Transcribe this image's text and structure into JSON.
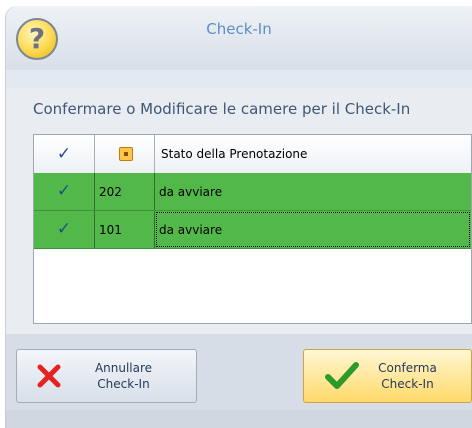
{
  "window": {
    "title": "Check-In",
    "question_icon_glyph": "?"
  },
  "content": {
    "instruction": "Confermare o Modificare le camere per il Check-In"
  },
  "grid": {
    "columns": [
      {
        "type": "icon",
        "icon": "checkmark-icon",
        "glyph": "✓"
      },
      {
        "type": "icon",
        "icon": "room-icon"
      },
      {
        "type": "text",
        "label": "Stato della Prenotazione"
      }
    ],
    "rows": [
      {
        "check_glyph": "✓",
        "room": "202",
        "state": "da avviare"
      },
      {
        "check_glyph": "✓",
        "room": "101",
        "state": "da avviare"
      }
    ],
    "row_color": "#53b84a"
  },
  "buttons": {
    "cancel": {
      "line1": "Annullare",
      "line2": "Check-In",
      "icon": "x-icon",
      "icon_color": "#e32222"
    },
    "confirm": {
      "line1": "Conferma",
      "line2": "Check-In",
      "icon": "checkmark-icon",
      "icon_color": "#2e9a29"
    }
  }
}
